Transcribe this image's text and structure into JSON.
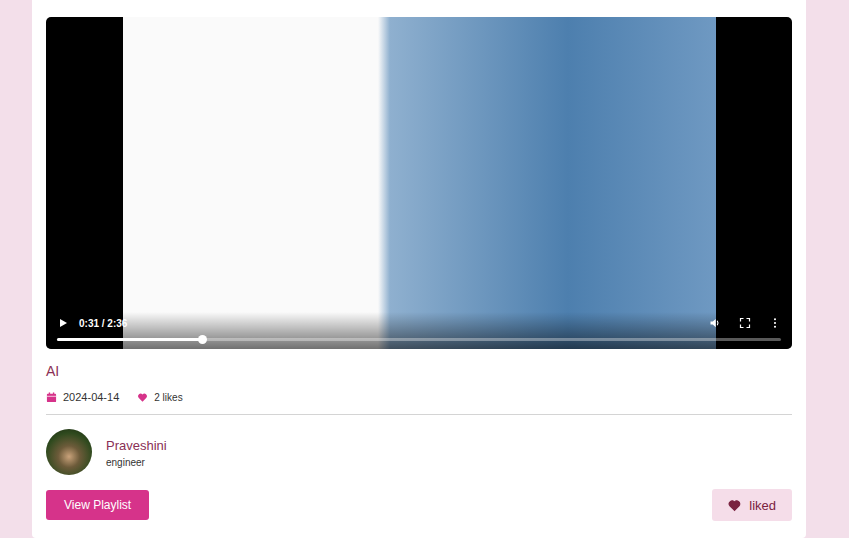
{
  "video": {
    "time": "0:31 / 2:36",
    "progress": 0.2,
    "playing": false
  },
  "title": "AI",
  "meta": {
    "date": "2024-04-14",
    "likes": "2 likes"
  },
  "author": {
    "name": "Praveshini",
    "role": "engineer"
  },
  "buttons": {
    "playlist": "View Playlist",
    "like": {
      "label": "liked",
      "liked": true
    }
  }
}
